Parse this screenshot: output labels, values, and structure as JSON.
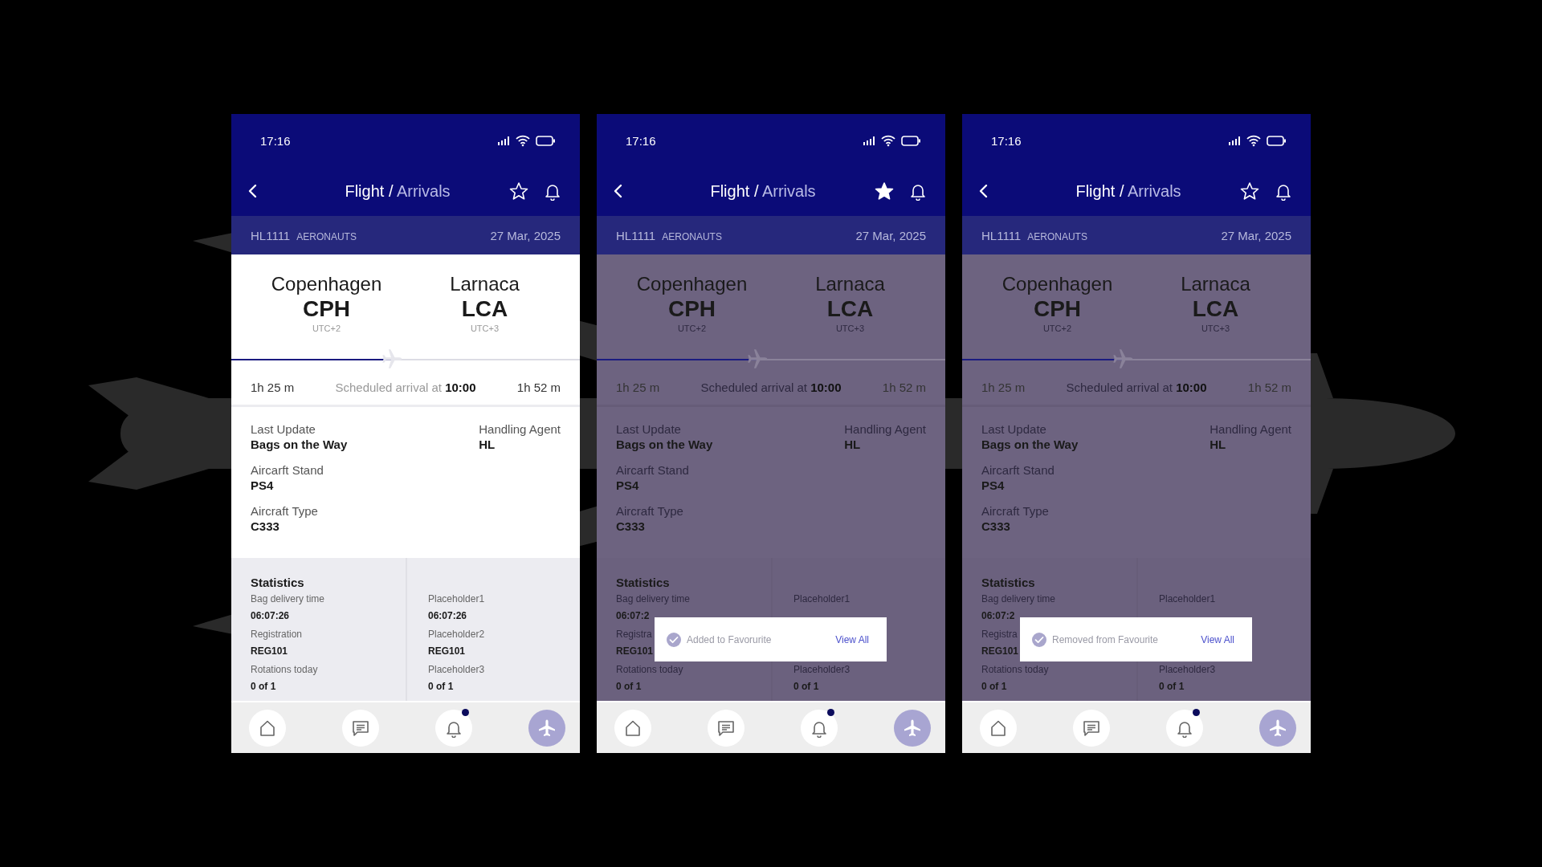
{
  "screens": [
    {
      "status_bar": {
        "time": "17:16"
      },
      "header": {
        "title": "Flight",
        "separator": "/",
        "subtitle": "Arrivals",
        "favourite": false
      },
      "flight": {
        "number": "HL1111",
        "airline": "AERONAUTS",
        "date": "27 Mar, 2025"
      },
      "route": {
        "origin": {
          "city": "Copenhagen",
          "code": "CPH",
          "tz": "UTC+2"
        },
        "destination": {
          "city": "Larnaca",
          "code": "LCA",
          "tz": "UTC+3"
        }
      },
      "progress": {
        "level": 0.46
      },
      "timing": {
        "elapsed": "1h 25 m",
        "scheduled": "Scheduled arrival at **10:00**",
        "remaining": "1h 52 m"
      },
      "details": {
        "left": [
          {
            "label": "Last Update",
            "value": "Bags on the Way"
          },
          {
            "label": "Aircarft Stand",
            "value": "PS4"
          },
          {
            "label": "Aircraft Type",
            "value": "C333"
          }
        ],
        "right": [
          {
            "label": "Handling Agent",
            "value": "HL"
          }
        ]
      },
      "statistics": {
        "title": "Statistics",
        "columns": [
          [
            {
              "label": "Bag delivery time",
              "value": "06:07:26"
            },
            {
              "label": "Registration",
              "value": "REG101"
            },
            {
              "label": "Rotations today",
              "value": "0 of 1"
            }
          ],
          [
            {
              "label": "Placeholder1",
              "value": "06:07:26"
            },
            {
              "label": "Placeholder2",
              "value": "REG101"
            },
            {
              "label": "Placeholder3",
              "value": "0 of 1"
            }
          ]
        ]
      },
      "dimmed": false,
      "nav": [
        {
          "kind": "home",
          "selected": false,
          "badge": false
        },
        {
          "kind": "messages",
          "selected": false,
          "badge": false
        },
        {
          "kind": "notifications",
          "selected": false,
          "badge": true
        },
        {
          "kind": "flights",
          "selected": true,
          "badge": false
        }
      ]
    },
    {
      "status_bar": {
        "time": "17:16"
      },
      "header": {
        "title": "Flight",
        "separator": "/",
        "subtitle": "Arrivals",
        "favourite": true
      },
      "flight": {
        "number": "HL1111",
        "airline": "AERONAUTS",
        "date": "27 Mar, 2025"
      },
      "route": {
        "origin": {
          "city": "Copenhagen",
          "code": "CPH",
          "tz": "UTC+2"
        },
        "destination": {
          "city": "Larnaca",
          "code": "LCA",
          "tz": "UTC+3"
        }
      },
      "progress": {
        "level": 0.46
      },
      "timing": {
        "elapsed": "1h 25 m",
        "scheduled": "Scheduled arrival at **10:00**",
        "remaining": "1h 52 m"
      },
      "details": {
        "left": [
          {
            "label": "Last Update",
            "value": "Bags on the Way"
          },
          {
            "label": "Aircarft Stand",
            "value": "PS4"
          },
          {
            "label": "Aircraft Type",
            "value": "C333"
          }
        ],
        "right": [
          {
            "label": "Handling Agent",
            "value": "HL"
          }
        ]
      },
      "statistics": {
        "title": "Statistics",
        "columns": [
          [
            {
              "label": "Bag delivery time",
              "value": "06:07:2"
            },
            {
              "label": "Registra",
              "value": "REG101"
            },
            {
              "label": "Rotations today",
              "value": "0 of 1"
            }
          ],
          [
            {
              "label": "Placeholder1"
            },
            {},
            {
              "label": "Placeholder3",
              "value": "0 of 1"
            }
          ]
        ]
      },
      "dimmed": true,
      "toast": {
        "message": "Added to Favorurite",
        "action": "View All"
      },
      "nav": [
        {
          "kind": "home",
          "selected": false,
          "badge": false
        },
        {
          "kind": "messages",
          "selected": false,
          "badge": false
        },
        {
          "kind": "notifications",
          "selected": false,
          "badge": true
        },
        {
          "kind": "flights",
          "selected": true,
          "badge": false
        }
      ]
    },
    {
      "status_bar": {
        "time": "17:16"
      },
      "header": {
        "title": "Flight",
        "separator": "/",
        "subtitle": "Arrivals",
        "favourite": false
      },
      "flight": {
        "number": "HL1111",
        "airline": "AERONAUTS",
        "date": "27 Mar, 2025"
      },
      "route": {
        "origin": {
          "city": "Copenhagen",
          "code": "CPH",
          "tz": "UTC+2"
        },
        "destination": {
          "city": "Larnaca",
          "code": "LCA",
          "tz": "UTC+3"
        }
      },
      "progress": {
        "level": 0.46
      },
      "timing": {
        "elapsed": "1h 25 m",
        "scheduled": "Scheduled arrival at **10:00**",
        "remaining": "1h 52 m"
      },
      "details": {
        "left": [
          {
            "label": "Last Update",
            "value": "Bags on the Way"
          },
          {
            "label": "Aircarft Stand",
            "value": "PS4"
          },
          {
            "label": "Aircraft Type",
            "value": "C333"
          }
        ],
        "right": [
          {
            "label": "Handling Agent",
            "value": "HL"
          }
        ]
      },
      "statistics": {
        "title": "Statistics",
        "columns": [
          [
            {
              "label": "Bag delivery time",
              "value": "06:07:2"
            },
            {
              "label": "Registra",
              "value": "REG101"
            },
            {
              "label": "Rotations today",
              "value": "0 of 1"
            }
          ],
          [
            {
              "label": "Placeholder1"
            },
            {},
            {
              "label": "Placeholder3",
              "value": "0 of 1"
            }
          ]
        ]
      },
      "dimmed": true,
      "toast": {
        "message": "Removed from Favourite",
        "action": "View All"
      },
      "nav": [
        {
          "kind": "home",
          "selected": false,
          "badge": false
        },
        {
          "kind": "messages",
          "selected": false,
          "badge": false
        },
        {
          "kind": "notifications",
          "selected": false,
          "badge": true
        },
        {
          "kind": "flights",
          "selected": true,
          "badge": false
        }
      ]
    }
  ]
}
